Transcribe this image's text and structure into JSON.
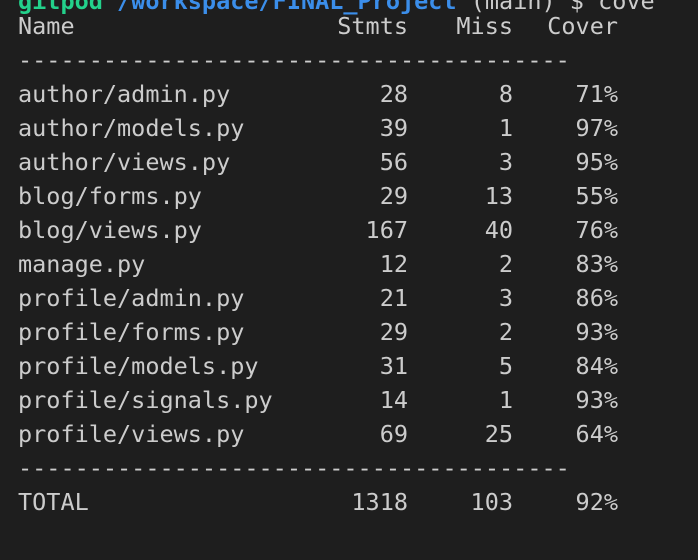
{
  "prompt": {
    "user": "gitpod",
    "path": " /workspace/FINAL_Project",
    "branch": " (main)",
    "symbol": " $",
    "command": " cove"
  },
  "report": {
    "headers": {
      "name": "Name",
      "stmts": "Stmts",
      "miss": "Miss",
      "cover": "Cover"
    },
    "separator": "---------------------------------------",
    "rows": [
      {
        "name": "author/admin.py",
        "stmts": "28",
        "miss": "8",
        "cover": "71%"
      },
      {
        "name": "author/models.py",
        "stmts": "39",
        "miss": "1",
        "cover": "97%"
      },
      {
        "name": "author/views.py",
        "stmts": "56",
        "miss": "3",
        "cover": "95%"
      },
      {
        "name": "blog/forms.py",
        "stmts": "29",
        "miss": "13",
        "cover": "55%"
      },
      {
        "name": "blog/views.py",
        "stmts": "167",
        "miss": "40",
        "cover": "76%"
      },
      {
        "name": "manage.py",
        "stmts": "12",
        "miss": "2",
        "cover": "83%"
      },
      {
        "name": "profile/admin.py",
        "stmts": "21",
        "miss": "3",
        "cover": "86%"
      },
      {
        "name": "profile/forms.py",
        "stmts": "29",
        "miss": "2",
        "cover": "93%"
      },
      {
        "name": "profile/models.py",
        "stmts": "31",
        "miss": "5",
        "cover": "84%"
      },
      {
        "name": "profile/signals.py",
        "stmts": "14",
        "miss": "1",
        "cover": "93%"
      },
      {
        "name": "profile/views.py",
        "stmts": "69",
        "miss": "25",
        "cover": "64%"
      }
    ],
    "total": {
      "name": "TOTAL",
      "stmts": "1318",
      "miss": "103",
      "cover": "92%"
    }
  },
  "colors": {
    "background": "#1e1e1e",
    "foreground": "#cccccc",
    "prompt_user": "#23d18b",
    "prompt_path": "#3b8eea"
  }
}
